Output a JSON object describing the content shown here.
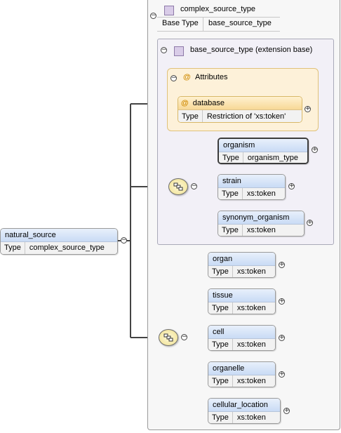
{
  "root": {
    "name": "natural_source",
    "type_label": "Type",
    "type_value": "complex_source_type"
  },
  "complex_type": {
    "name": "complex_source_type",
    "base_label": "Base Type",
    "base_value": "base_source_type"
  },
  "extension": {
    "title": "base_source_type (extension base)"
  },
  "attributes": {
    "title": "Attributes",
    "items": [
      {
        "name": "database",
        "type_label": "Type",
        "type_value": "Restriction of 'xs:token'"
      }
    ]
  },
  "sequence1": [
    {
      "name": "organism",
      "type_label": "Type",
      "type_value": "organism_type"
    },
    {
      "name": "strain",
      "type_label": "Type",
      "type_value": "xs:token"
    },
    {
      "name": "synonym_organism",
      "type_label": "Type",
      "type_value": "xs:token"
    }
  ],
  "sequence2": [
    {
      "name": "organ",
      "type_label": "Type",
      "type_value": "xs:token"
    },
    {
      "name": "tissue",
      "type_label": "Type",
      "type_value": "xs:token"
    },
    {
      "name": "cell",
      "type_label": "Type",
      "type_value": "xs:token"
    },
    {
      "name": "organelle",
      "type_label": "Type",
      "type_value": "xs:token"
    },
    {
      "name": "cellular_location",
      "type_label": "Type",
      "type_value": "xs:token"
    }
  ],
  "symbols": {
    "collapse": "−",
    "expand": "+",
    "attribute": "@"
  },
  "colors": {
    "element_header": "#c9dbf5",
    "attribute_header": "#f7d896",
    "attribute_group_bg": "#fdf1d9",
    "extension_bg": "#f2f0f7",
    "compositor": "#efe08e"
  }
}
